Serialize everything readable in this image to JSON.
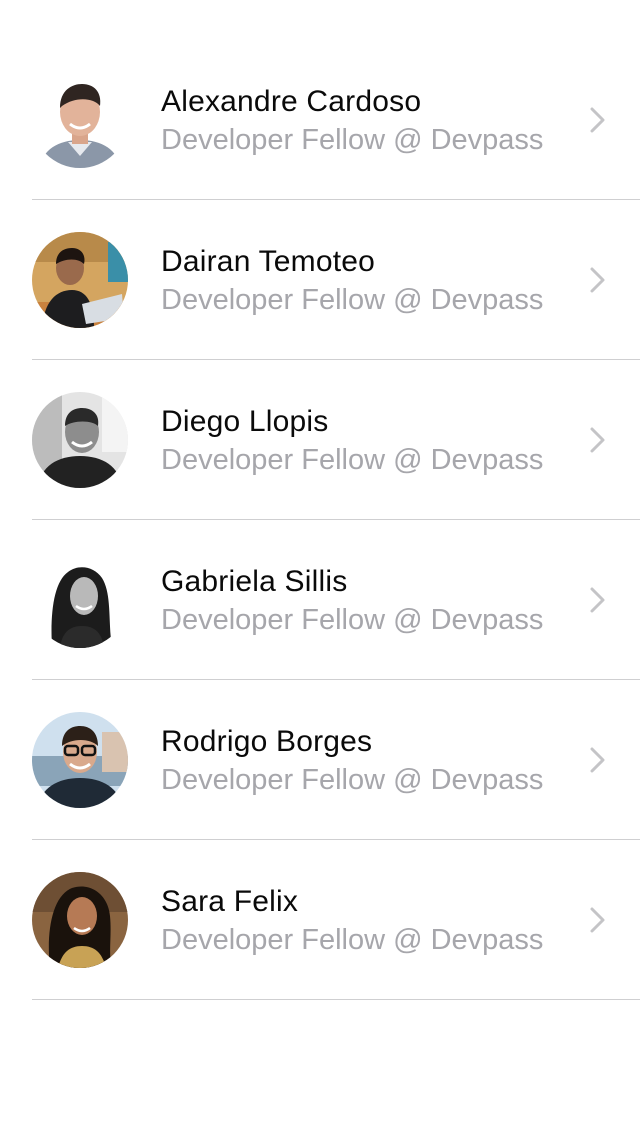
{
  "colors": {
    "name_text": "#0a0a0a",
    "subtitle_text": "#a6a6ab",
    "separator": "#cfcfd1",
    "chevron": "#c4c4c7",
    "background": "#ffffff"
  },
  "people": [
    {
      "name": "Alexandre Cardoso",
      "role": "Developer Fellow @ Devpass",
      "avatar": "avatar-icon"
    },
    {
      "name": "Dairan Temoteo",
      "role": "Developer Fellow @ Devpass",
      "avatar": "avatar-icon"
    },
    {
      "name": "Diego Llopis",
      "role": "Developer Fellow @ Devpass",
      "avatar": "avatar-icon"
    },
    {
      "name": "Gabriela Sillis",
      "role": "Developer Fellow @ Devpass",
      "avatar": "avatar-icon"
    },
    {
      "name": "Rodrigo Borges",
      "role": "Developer Fellow @ Devpass",
      "avatar": "avatar-icon"
    },
    {
      "name": "Sara Felix",
      "role": "Developer Fellow @ Devpass",
      "avatar": "avatar-icon"
    }
  ],
  "chevron_icon": "chevron-right-icon"
}
